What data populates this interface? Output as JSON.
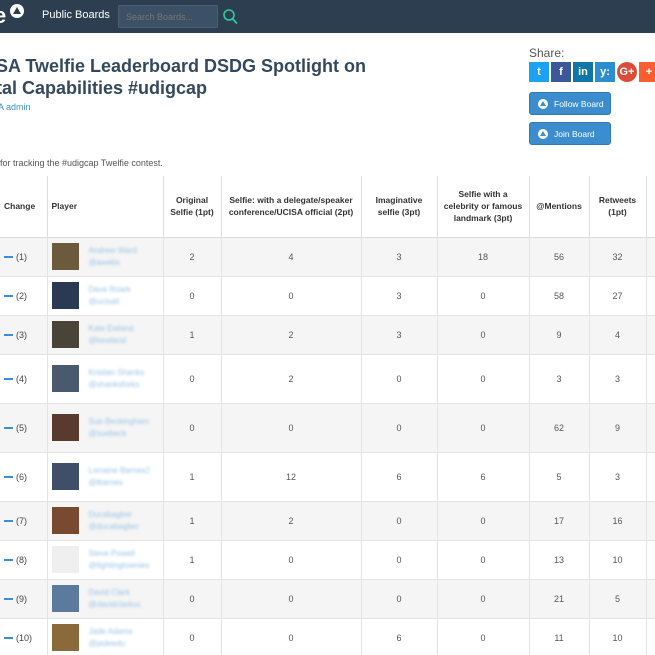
{
  "nav": {
    "logo_text": "e",
    "link": "Public Boards",
    "search_placeholder": "Search Boards..."
  },
  "board": {
    "title_line1": "SA Twelfie Leaderboard DSDG Spotlight on",
    "title_line2": "tal Capabilities #udigcap",
    "owner": "A admin",
    "description": "for tracking the #udigcap Twelfie contest."
  },
  "share": {
    "label": "Share:",
    "buttons": [
      {
        "icon": "twitter-icon",
        "glyph": "t"
      },
      {
        "icon": "facebook-icon",
        "glyph": "f"
      },
      {
        "icon": "linkedin-icon",
        "glyph": "in"
      },
      {
        "icon": "yammer-icon",
        "glyph": "y:"
      },
      {
        "icon": "google-plus-icon",
        "glyph": "G+"
      },
      {
        "icon": "addthis-icon",
        "glyph": "+"
      }
    ]
  },
  "actions": {
    "follow": "Follow Board",
    "join": "Join Board"
  },
  "table": {
    "headers": [
      "Change",
      "Player",
      "Original Selfie (1pt)",
      "Selfie: with a delegate/speaker conference/UCISA official (2pt)",
      "Imaginative selfie (3pt)",
      "Selfie with a celebrity or famous landmark (3pt)",
      "@Mentions",
      "Retweets (1pt)"
    ],
    "rows": [
      {
        "change": "(1)",
        "name": "Andrew Ward",
        "handle": "@awebs",
        "avatar": "#6b5a3c",
        "v": [
          "2",
          "4",
          "3",
          "18",
          "56",
          "32"
        ]
      },
      {
        "change": "(2)",
        "name": "Dave Roark",
        "handle": "@ucisait",
        "avatar": "#2a3a55",
        "v": [
          "0",
          "0",
          "3",
          "0",
          "58",
          "27"
        ]
      },
      {
        "change": "(3)",
        "name": "Kate Ewland",
        "handle": "@kewland",
        "avatar": "#4a4438",
        "v": [
          "1",
          "2",
          "3",
          "0",
          "9",
          "4"
        ]
      },
      {
        "change": "(4)",
        "name": "Kristian Shanks",
        "handle": "@shanksforks",
        "avatar": "#4a5a6e",
        "v": [
          "0",
          "2",
          "0",
          "0",
          "3",
          "3"
        ]
      },
      {
        "change": "(5)",
        "name": "Sue Beckingham",
        "handle": "@suebeck",
        "avatar": "#5a3a2c",
        "v": [
          "0",
          "0",
          "0",
          "0",
          "62",
          "9"
        ]
      },
      {
        "change": "(6)",
        "name": "Lorraine Barnes2",
        "handle": "@lbarnes",
        "avatar": "#3f4f6a",
        "v": [
          "1",
          "12",
          "6",
          "6",
          "5",
          "3"
        ]
      },
      {
        "change": "(7)",
        "name": "Ducabagber",
        "handle": "@ducabagber",
        "avatar": "#7a4a30",
        "v": [
          "1",
          "2",
          "0",
          "0",
          "17",
          "16"
        ]
      },
      {
        "change": "(8)",
        "name": "Steve Powell",
        "handle": "@fightingtownies",
        "avatar": "#efefef",
        "v": [
          "1",
          "0",
          "0",
          "0",
          "13",
          "10"
        ]
      },
      {
        "change": "(9)",
        "name": "David Clark",
        "handle": "@davidclarkuc",
        "avatar": "#5b7a9e",
        "v": [
          "0",
          "0",
          "0",
          "0",
          "21",
          "5"
        ]
      },
      {
        "change": "(10)",
        "name": "Jade Adams",
        "handle": "@jadeedu",
        "avatar": "#8a6a3a",
        "v": [
          "0",
          "0",
          "6",
          "0",
          "11",
          "10"
        ]
      }
    ]
  }
}
